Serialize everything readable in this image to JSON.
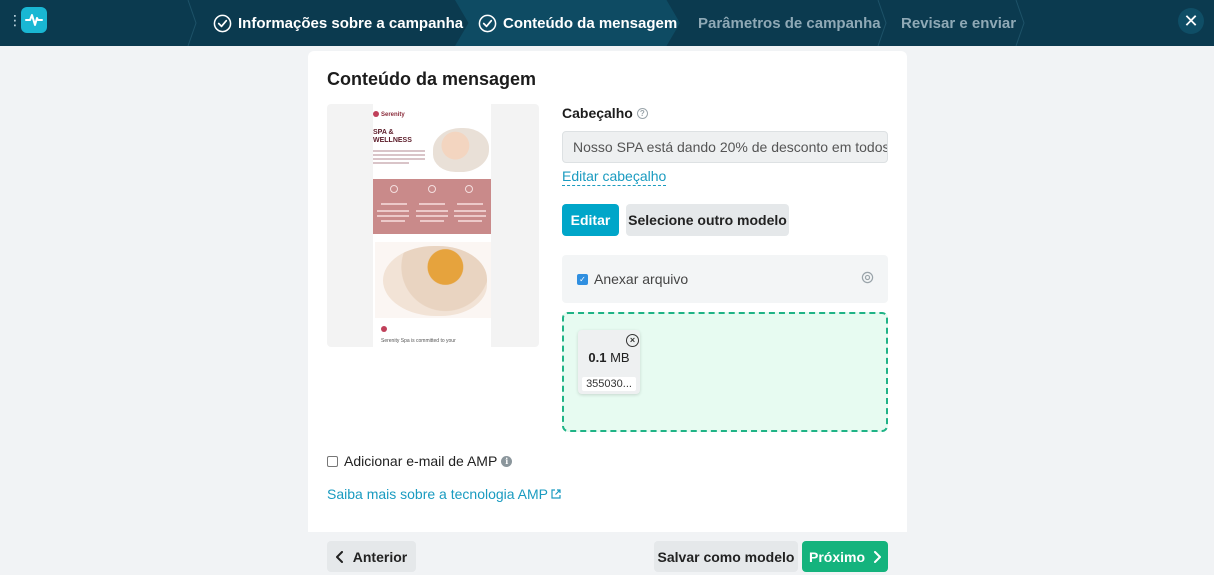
{
  "topbar": {
    "steps": [
      {
        "label": "Informações sobre a campanha",
        "state": "done"
      },
      {
        "label": "Conteúdo da mensagem",
        "state": "active"
      },
      {
        "label": "Parâmetros de campanha",
        "state": "pending"
      },
      {
        "label": "Revisar e enviar",
        "state": "pending"
      }
    ],
    "close_symbol": "✕"
  },
  "card": {
    "title": "Conteúdo da mensagem",
    "preview": {
      "brand": "Serenity",
      "headline_1": "SPA &",
      "headline_2": "WELLNESS",
      "footer_text": "Serenity Spa is committed to your"
    },
    "header_label": "Cabeçalho",
    "header_value": "Nosso SPA está dando 20% de desconto em todos",
    "edit_header_link": "Editar cabeçalho",
    "edit_button": "Editar",
    "select_template_button": "Selecione outro modelo",
    "attach_label": "Anexar arquivo",
    "attach_checked": true,
    "file": {
      "size_value": "0.1",
      "size_unit": "MB",
      "name": "355030..."
    },
    "amp_label": "Adicionar e-mail de AMP",
    "amp_checked": false,
    "amp_link": "Saiba mais sobre a tecnologia AMP",
    "footer": {
      "back_button": "Anterior",
      "save_template_button": "Salvar como modelo",
      "next_button": "Próximo"
    }
  },
  "colors": {
    "topbar": "#0b3a4f",
    "accent": "#00a6c9",
    "link": "#1a9bc0",
    "success": "#14b37d",
    "dropzone": "#e7fbf1"
  }
}
